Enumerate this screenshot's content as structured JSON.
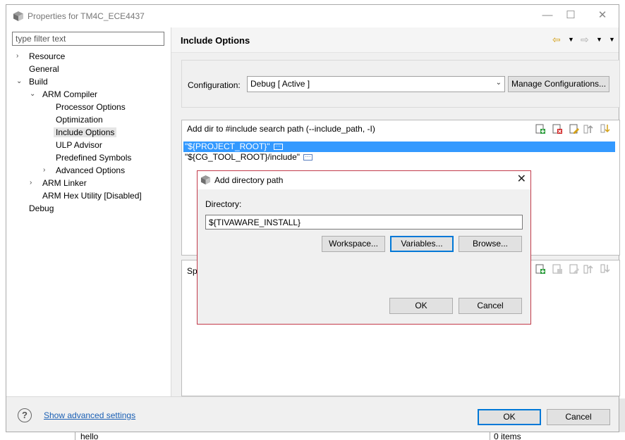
{
  "window": {
    "title": "Properties for TM4C_ECE4437",
    "controls": {
      "minimize": "—",
      "maximize": "☐",
      "close": "✕"
    }
  },
  "filter": {
    "placeholder": "type filter text",
    "value": ""
  },
  "tree": {
    "items": [
      {
        "label": "Resource",
        "twisty": "›"
      },
      {
        "label": "General",
        "twisty": ""
      },
      {
        "label": "Build",
        "twisty": "⌄"
      },
      {
        "label": "ARM Compiler",
        "twisty": "⌄"
      },
      {
        "label": "Processor Options",
        "twisty": ""
      },
      {
        "label": "Optimization",
        "twisty": ""
      },
      {
        "label": "Include Options",
        "twisty": "",
        "selected": true
      },
      {
        "label": "ULP Advisor",
        "twisty": ""
      },
      {
        "label": "Predefined Symbols",
        "twisty": ""
      },
      {
        "label": "Advanced Options",
        "twisty": "›"
      },
      {
        "label": "ARM Linker",
        "twisty": "›"
      },
      {
        "label": "ARM Hex Utility  [Disabled]",
        "twisty": ""
      },
      {
        "label": "Debug",
        "twisty": ""
      }
    ]
  },
  "page": {
    "title": "Include Options",
    "nav_icons": [
      "back-arrow-icon",
      "dropdown-icon",
      "forward-arrow-icon",
      "dropdown-icon",
      "view-menu-icon"
    ]
  },
  "configuration": {
    "label": "Configuration:",
    "selected": "Debug  [ Active ]",
    "manage_button": "Manage Configurations..."
  },
  "include_paths": {
    "header": "Add dir to #include search path (--include_path, -I)",
    "rows": [
      "\"${PROJECT_ROOT}\"",
      "\"${CG_TOOL_ROOT}/include\""
    ],
    "toolbar_icons": [
      "add-icon",
      "delete-icon",
      "edit-icon",
      "move-up-icon",
      "move-down-icon"
    ]
  },
  "second_list": {
    "header_fragment": "Sp"
  },
  "dialog": {
    "title": "Add directory path",
    "close": "✕",
    "directory_label": "Directory:",
    "directory_value": "${TIVAWARE_INSTALL}",
    "workspace_button": "Workspace...",
    "variables_button": "Variables...",
    "browse_button": "Browse...",
    "ok_button": "OK",
    "cancel_button": "Cancel"
  },
  "bottom": {
    "help": "?",
    "advanced_link": "Show advanced settings",
    "ok_button": "OK",
    "cancel_button": "Cancel"
  },
  "background": {
    "project_item": "hello",
    "items_count": "0 items"
  },
  "colors": {
    "selection": "#3399ff",
    "link": "#1a5fb4",
    "focus_border": "#0078d7",
    "dialog_border": "#c23a4a"
  }
}
